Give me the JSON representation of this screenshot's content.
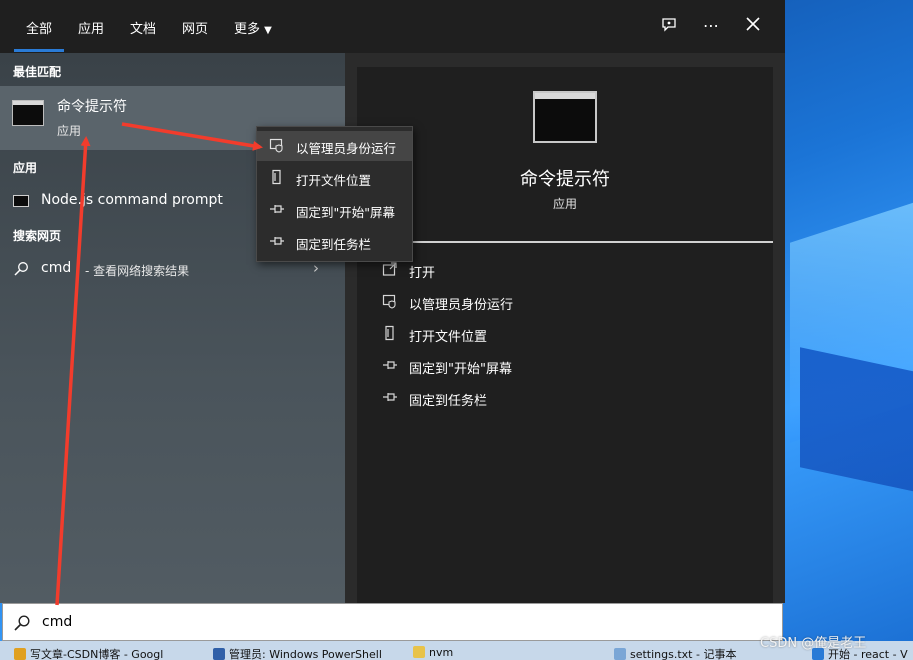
{
  "tabs": [
    {
      "label": "全部"
    },
    {
      "label": "应用"
    },
    {
      "label": "文档"
    },
    {
      "label": "网页"
    },
    {
      "label": "更多"
    }
  ],
  "top_icons": [
    "feedback-icon",
    "more-icon",
    "close-icon"
  ],
  "left": {
    "best_match_header": "最佳匹配",
    "best_match": {
      "title": "命令提示符",
      "subtitle": "应用"
    },
    "apps_header": "应用",
    "app_item": "Node.js command prompt",
    "web_header": "搜索网页",
    "web_query": "cmd",
    "web_rest": "- 查看网络搜索结果"
  },
  "context_menu": [
    {
      "label": "以管理员身份运行",
      "icon": "shield-icon"
    },
    {
      "label": "打开文件位置",
      "icon": "file-icon"
    },
    {
      "label": "固定到\"开始\"屏幕",
      "icon": "pin-icon"
    },
    {
      "label": "固定到任务栏",
      "icon": "pin-icon"
    }
  ],
  "right": {
    "title": "命令提示符",
    "subtitle": "应用",
    "actions": [
      {
        "label": "打开",
        "icon": "open-icon"
      },
      {
        "label": "以管理员身份运行",
        "icon": "shield-icon"
      },
      {
        "label": "打开文件位置",
        "icon": "file-icon"
      },
      {
        "label": "固定到\"开始\"屏幕",
        "icon": "pin-icon"
      },
      {
        "label": "固定到任务栏",
        "icon": "pin-icon"
      }
    ]
  },
  "search": {
    "value": "cmd"
  },
  "taskbar": [
    {
      "label": "写文章-CSDN博客 - Googl",
      "icon_color": "#e0a020"
    },
    {
      "label": "管理员: Windows PowerShell",
      "icon_color": "#2f5fa8"
    },
    {
      "label": "nvm",
      "icon_color": "#e8c34a"
    },
    {
      "label": "settings.txt - 记事本",
      "icon_color": "#7aa6d6"
    },
    {
      "label": "开始 - react - V",
      "icon_color": "#2a7bd6"
    }
  ],
  "watermark": "CSDN @俺是老王",
  "colors": {
    "accent": "#2a7bd6",
    "arrow": "#f23c2c"
  }
}
